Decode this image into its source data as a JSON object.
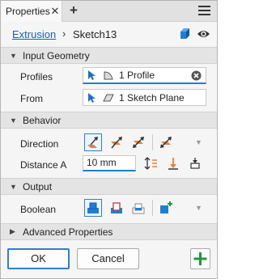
{
  "titlebar": {
    "tab_label": "Properties",
    "close_glyph": "✕",
    "add_glyph": "+"
  },
  "breadcrumb": {
    "parent": "Extrusion",
    "separator": "›",
    "current": "Sketch13"
  },
  "sections": {
    "input_geometry": "Input Geometry",
    "behavior": "Behavior",
    "output": "Output",
    "advanced": "Advanced Properties"
  },
  "input": {
    "profiles_label": "Profiles",
    "profiles_value": "1 Profile",
    "from_label": "From",
    "from_value": "1 Sketch Plane"
  },
  "behavior": {
    "direction_label": "Direction",
    "distance_label": "Distance A",
    "distance_value": "10 mm"
  },
  "output": {
    "boolean_label": "Boolean"
  },
  "footer": {
    "ok_label": "OK",
    "cancel_label": "Cancel"
  },
  "icons": [
    "close-icon",
    "plus-icon",
    "menu-icon",
    "cube-icon",
    "eye-icon",
    "cursor-icon",
    "profile-icon",
    "plane-icon",
    "clear-icon",
    "direction-default-icon",
    "direction-flipped-icon",
    "direction-symmetric-icon",
    "direction-asymmetric-icon",
    "flip-icon",
    "measure-icon",
    "taper-icon",
    "join-icon",
    "cut-icon",
    "intersect-icon",
    "new-solid-icon",
    "chevron-down-icon",
    "add-icon"
  ],
  "colors": {
    "accent": "#2f7fcf",
    "link": "#1a5fb4",
    "orange": "#e8823a",
    "green": "#1e9a3c"
  }
}
